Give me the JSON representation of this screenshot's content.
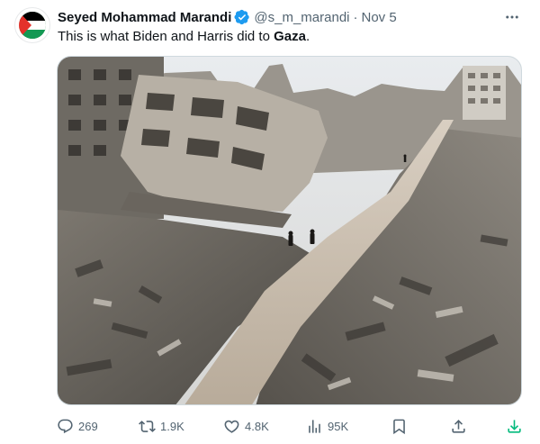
{
  "author": {
    "name": "Seyed Mohammad Marandi",
    "handle": "@s_m_marandi",
    "separator": "·",
    "date": "Nov 5"
  },
  "tweet": {
    "text_before": "This is what Biden and Harris did to ",
    "text_bold": "Gaza",
    "text_after": "."
  },
  "media": {
    "icon": "photo-rubble-street"
  },
  "metrics": {
    "replies": "269",
    "reposts": "1.9K",
    "likes": "4.8K",
    "views": "95K"
  },
  "colors": {
    "text": "#0f1419",
    "secondary": "#536471",
    "verified": "#1d9bf0",
    "border": "#cfd9de",
    "download": "#00ba7c"
  }
}
